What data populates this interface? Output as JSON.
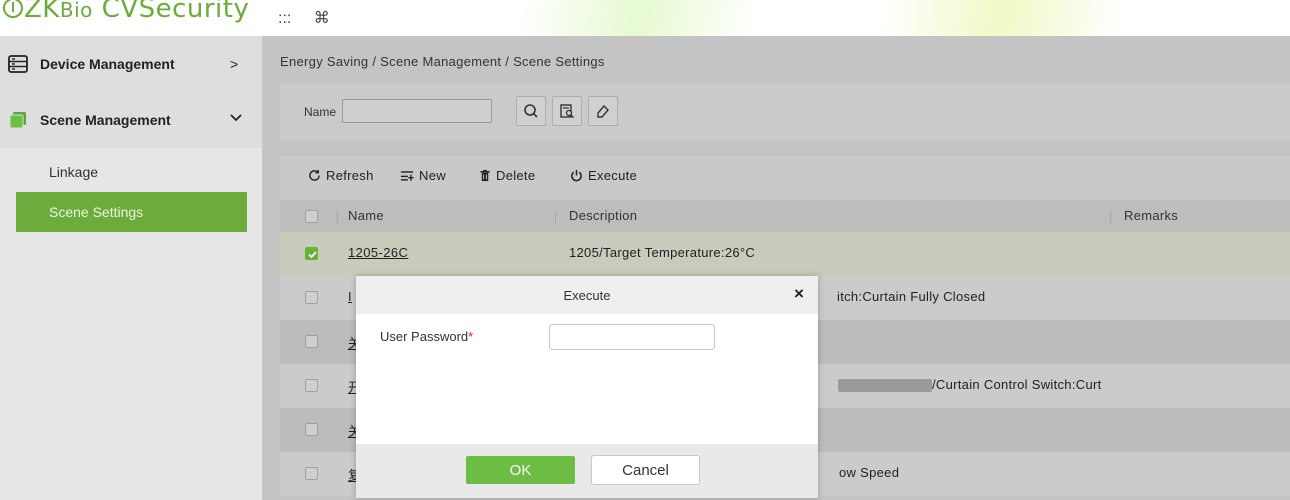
{
  "app": {
    "logo_text": "ZKBio CVSecurity",
    "logo_prefix": "ZK",
    "logo_bio": "Bio",
    "logo_suffix": " CVSecurity",
    "menu_icon": ":::",
    "command_icon": "⌘"
  },
  "sidebar": {
    "items": [
      {
        "label": "Device Management",
        "arrow": ">",
        "icon": "server-icon"
      },
      {
        "label": "Scene Management",
        "arrow": "⌄",
        "icon": "scene-icon"
      }
    ],
    "sub_items": [
      {
        "label": "Linkage",
        "active": false
      },
      {
        "label": "Scene Settings",
        "active": true
      }
    ],
    "collapse_glyph": "«"
  },
  "breadcrumb": "Energy Saving / Scene Management / Scene Settings",
  "search": {
    "name_label": "Name",
    "name_value": "",
    "buttons": [
      "search-icon",
      "advanced-search-icon",
      "clear-icon"
    ]
  },
  "toolbar": {
    "refresh": "Refresh",
    "new": "New",
    "delete": "Delete",
    "execute": "Execute"
  },
  "table": {
    "columns": [
      "Name",
      "Description",
      "Remarks"
    ],
    "rows": [
      {
        "checked": true,
        "name": "1205-26C",
        "description": "1205/Target Temperature:26°C"
      },
      {
        "checked": false,
        "name": "I",
        "description": "itch:Curtain Fully Closed"
      },
      {
        "checked": false,
        "name": "关",
        "description": ""
      },
      {
        "checked": false,
        "name": "开",
        "description": "/Curtain Control Switch:Curt"
      },
      {
        "checked": false,
        "name": "关",
        "description": ""
      },
      {
        "checked": false,
        "name": "复",
        "description": "ow Speed"
      }
    ]
  },
  "modal": {
    "title": "Execute",
    "close": "×",
    "password_label": "User Password",
    "required_mark": "*",
    "password_value": "",
    "ok": "OK",
    "cancel": "Cancel"
  },
  "colors": {
    "brand_green": "#6cac3d",
    "ok_green": "#6dbd45",
    "checkbox_green": "#67b33a",
    "required_red": "#e02020"
  }
}
